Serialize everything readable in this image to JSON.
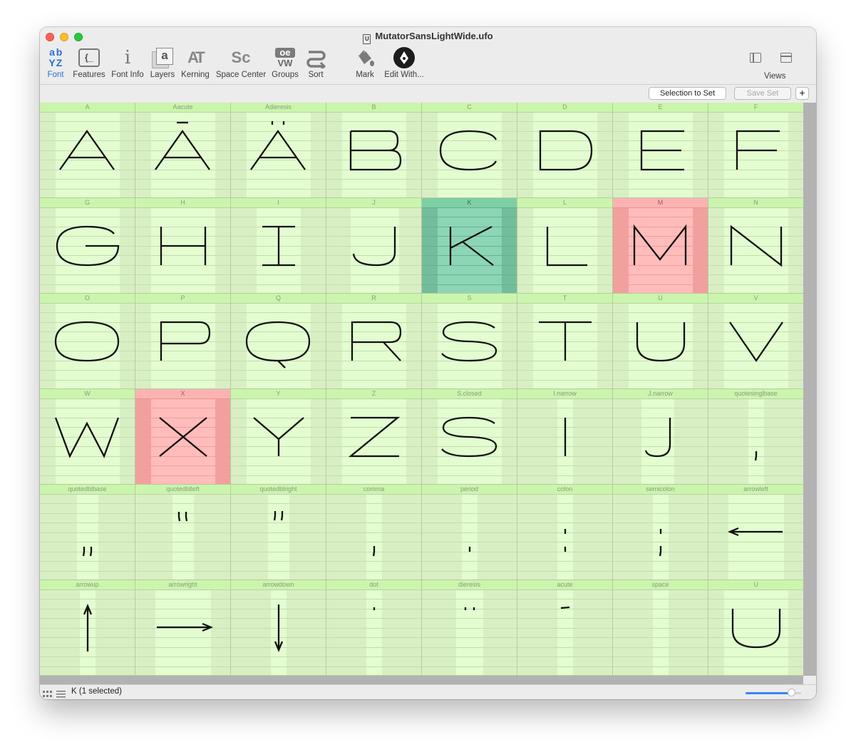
{
  "window": {
    "title": "MutatorSansLightWide.ufo",
    "doc_icon_letter": "U"
  },
  "toolbar": {
    "font": "Font",
    "features": "Features",
    "font_info": "Font Info",
    "layers": "Layers",
    "kerning": "Kerning",
    "space_center": "Space Center",
    "groups": "Groups",
    "sort": "Sort",
    "mark": "Mark",
    "edit_with": "Edit With...",
    "views": "Views",
    "font_icon_text": [
      "a",
      "b",
      "Y",
      "Z"
    ],
    "features_icon_text": "{_",
    "kerning_icon_text": "AT",
    "space_center_icon_text": "Sc",
    "groups_icon_text": [
      "oe",
      "VW"
    ],
    "layers_icon_text": "a",
    "font_info_icon_text": "i"
  },
  "setbar": {
    "selection_to_set": "Selection to Set",
    "save_set": "Save Set",
    "add": "+"
  },
  "glyphs": [
    {
      "name": "A",
      "glyph": "A",
      "state": "normal"
    },
    {
      "name": "Aacute",
      "glyph": "Á",
      "state": "normal"
    },
    {
      "name": "Adieresis",
      "glyph": "Ä",
      "state": "normal"
    },
    {
      "name": "B",
      "glyph": "B",
      "state": "normal"
    },
    {
      "name": "C",
      "glyph": "C",
      "state": "normal"
    },
    {
      "name": "D",
      "glyph": "D",
      "state": "normal"
    },
    {
      "name": "E",
      "glyph": "E",
      "state": "normal"
    },
    {
      "name": "F",
      "glyph": "F",
      "state": "normal"
    },
    {
      "name": "G",
      "glyph": "G",
      "state": "normal"
    },
    {
      "name": "H",
      "glyph": "H",
      "state": "normal"
    },
    {
      "name": "I",
      "glyph": "I",
      "state": "normal"
    },
    {
      "name": "J",
      "glyph": "J",
      "state": "normal"
    },
    {
      "name": "K",
      "glyph": "K",
      "state": "selected"
    },
    {
      "name": "L",
      "glyph": "L",
      "state": "normal"
    },
    {
      "name": "M",
      "glyph": "M",
      "state": "marked-red"
    },
    {
      "name": "N",
      "glyph": "N",
      "state": "normal"
    },
    {
      "name": "O",
      "glyph": "O",
      "state": "normal"
    },
    {
      "name": "P",
      "glyph": "P",
      "state": "normal"
    },
    {
      "name": "Q",
      "glyph": "Q",
      "state": "normal"
    },
    {
      "name": "R",
      "glyph": "R",
      "state": "normal"
    },
    {
      "name": "S",
      "glyph": "S",
      "state": "normal"
    },
    {
      "name": "T",
      "glyph": "T",
      "state": "normal"
    },
    {
      "name": "U",
      "glyph": "U",
      "state": "normal"
    },
    {
      "name": "V",
      "glyph": "V",
      "state": "normal"
    },
    {
      "name": "W",
      "glyph": "W",
      "state": "normal"
    },
    {
      "name": "X",
      "glyph": "X",
      "state": "marked-red"
    },
    {
      "name": "Y",
      "glyph": "Y",
      "state": "normal"
    },
    {
      "name": "Z",
      "glyph": "Z",
      "state": "normal"
    },
    {
      "name": "S.closed",
      "glyph": "S",
      "state": "normal"
    },
    {
      "name": "I.narrow",
      "glyph": "I",
      "state": "normal"
    },
    {
      "name": "J.narrow",
      "glyph": "J",
      "state": "normal"
    },
    {
      "name": "quotesinglbase",
      "glyph": "‚",
      "state": "normal"
    },
    {
      "name": "quotedblbase",
      "glyph": "„",
      "state": "normal"
    },
    {
      "name": "quotedblleft",
      "glyph": "“",
      "state": "normal"
    },
    {
      "name": "quotedblright",
      "glyph": "”",
      "state": "normal"
    },
    {
      "name": "comma",
      "glyph": ",",
      "state": "normal"
    },
    {
      "name": "period",
      "glyph": ".",
      "state": "normal"
    },
    {
      "name": "colon",
      "glyph": ":",
      "state": "normal"
    },
    {
      "name": "semicolon",
      "glyph": ";",
      "state": "normal"
    },
    {
      "name": "arrowleft",
      "glyph": "←",
      "state": "normal"
    },
    {
      "name": "arrowup",
      "glyph": "↑",
      "state": "normal"
    },
    {
      "name": "arrowright",
      "glyph": "→",
      "state": "normal"
    },
    {
      "name": "arrowdown",
      "glyph": "↓",
      "state": "normal"
    },
    {
      "name": "dot",
      "glyph": "˙",
      "state": "normal"
    },
    {
      "name": "dieresis",
      "glyph": "¨",
      "state": "normal"
    },
    {
      "name": "acute",
      "glyph": "´",
      "state": "normal"
    },
    {
      "name": "space",
      "glyph": " ",
      "state": "normal"
    },
    {
      "name": "U",
      "glyph": "U",
      "state": "normal"
    }
  ],
  "status": {
    "text": "K (1 selected)",
    "zoom_fraction": 0.82
  },
  "colors": {
    "accent": "#2b6fd6",
    "cell_bg": "#d8efc4",
    "selected": "#72bd9a",
    "marked_red": "#f2a09e"
  }
}
